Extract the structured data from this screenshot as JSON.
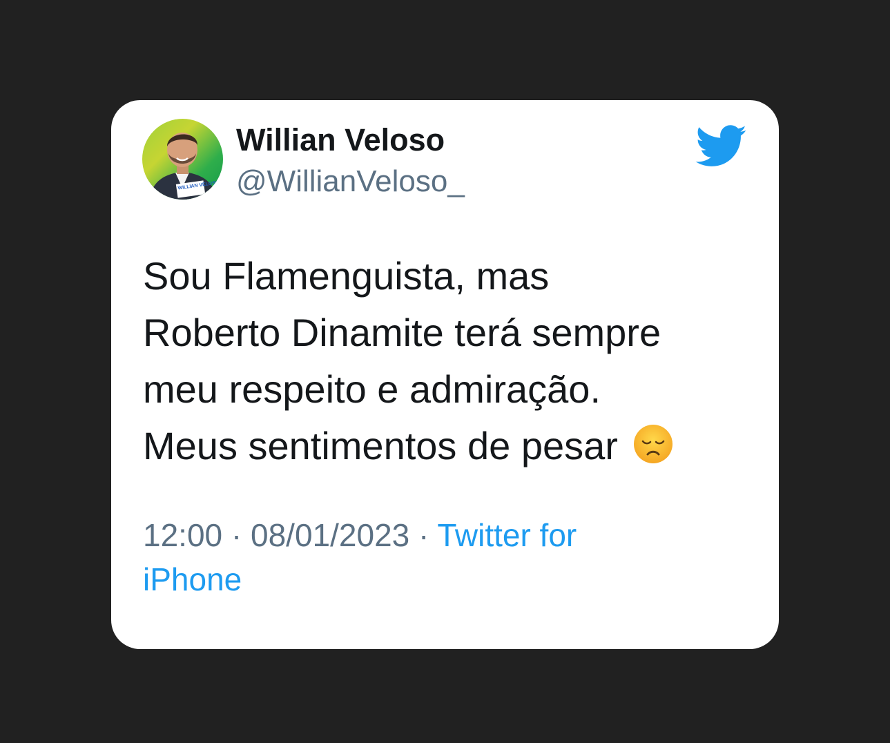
{
  "tweet": {
    "display_name": "Willian Veloso",
    "handle": "@WillianVeloso_",
    "avatar_badge": "WILLIAN VELOSO",
    "text_lines": [
      "Sou Flamenguista, mas",
      "Roberto Dinamite terá sempre",
      "meu respeito e admiração.",
      "Meus sentimentos de pesar"
    ],
    "emoji": "disappointed-face-icon",
    "time": "12:00",
    "separator": "·",
    "date": "08/01/2023",
    "source_part1": "Twitter for",
    "source_part2": "iPhone"
  },
  "colors": {
    "background": "#212121",
    "card": "#ffffff",
    "name": "#14171a",
    "secondary": "#5b7083",
    "link": "#1d9bf0",
    "bird": "#1d9bf0"
  },
  "icons": {
    "brand": "twitter-bird-icon"
  }
}
